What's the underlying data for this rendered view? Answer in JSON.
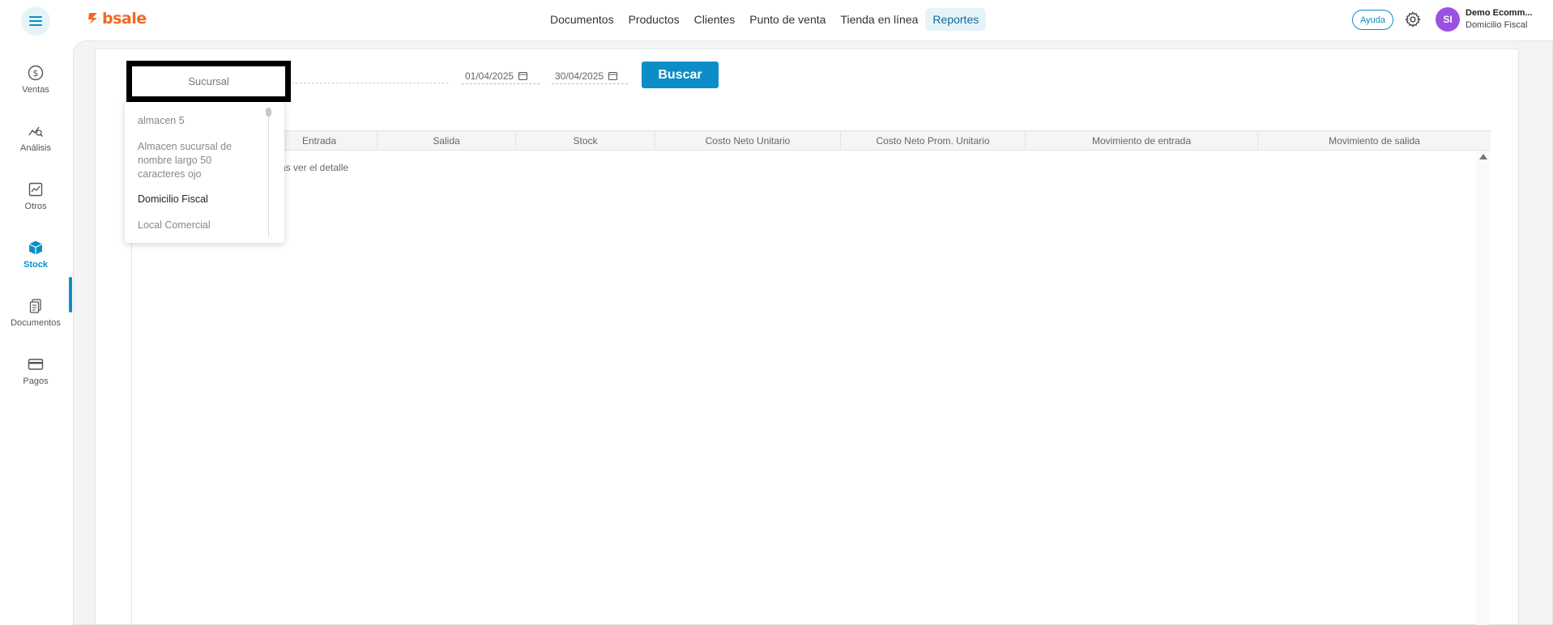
{
  "brand": {
    "name": "bsale",
    "color": "#f26722"
  },
  "topnav": {
    "items": [
      {
        "label": "Documentos"
      },
      {
        "label": "Productos"
      },
      {
        "label": "Clientes"
      },
      {
        "label": "Punto de venta"
      },
      {
        "label": "Tienda en línea"
      },
      {
        "label": "Reportes"
      }
    ],
    "active": "Reportes"
  },
  "header": {
    "help_label": "Ayuda",
    "avatar_initials": "SI",
    "user_name": "Demo Ecomm...",
    "user_branch": "Domicilio Fiscal"
  },
  "sidebar": {
    "items": [
      {
        "label": "Ventas",
        "icon": "dollar-circle-icon"
      },
      {
        "label": "Análisis",
        "icon": "analytics-icon"
      },
      {
        "label": "Otros",
        "icon": "chart-box-icon"
      },
      {
        "label": "Stock",
        "icon": "box-icon"
      },
      {
        "label": "Documentos",
        "icon": "document-icon"
      },
      {
        "label": "Pagos",
        "icon": "card-icon"
      }
    ],
    "active": "Stock"
  },
  "filters": {
    "branch_placeholder": "Sucursal",
    "date_from": "01/04/2025",
    "date_to": "30/04/2025",
    "search_label": "Buscar"
  },
  "dropdown": {
    "options": [
      {
        "label": "almacen 5"
      },
      {
        "label": "Almacen sucursal de nombre largo 50 caracteres ojo"
      },
      {
        "label": "Domicilio Fiscal"
      },
      {
        "label": "Local Comercial"
      }
    ],
    "selected": "Domicilio Fiscal"
  },
  "table": {
    "columns": [
      "Entrada",
      "Salida",
      "Stock",
      "Costo Neto Unitario",
      "Costo Neto Prom. Unitario",
      "Movimiento de entrada",
      "Movimiento de salida"
    ],
    "empty_message_visible": "as ver el detalle"
  },
  "colors": {
    "accent": "#0b8ec7",
    "avatar": "#9b51e0"
  }
}
